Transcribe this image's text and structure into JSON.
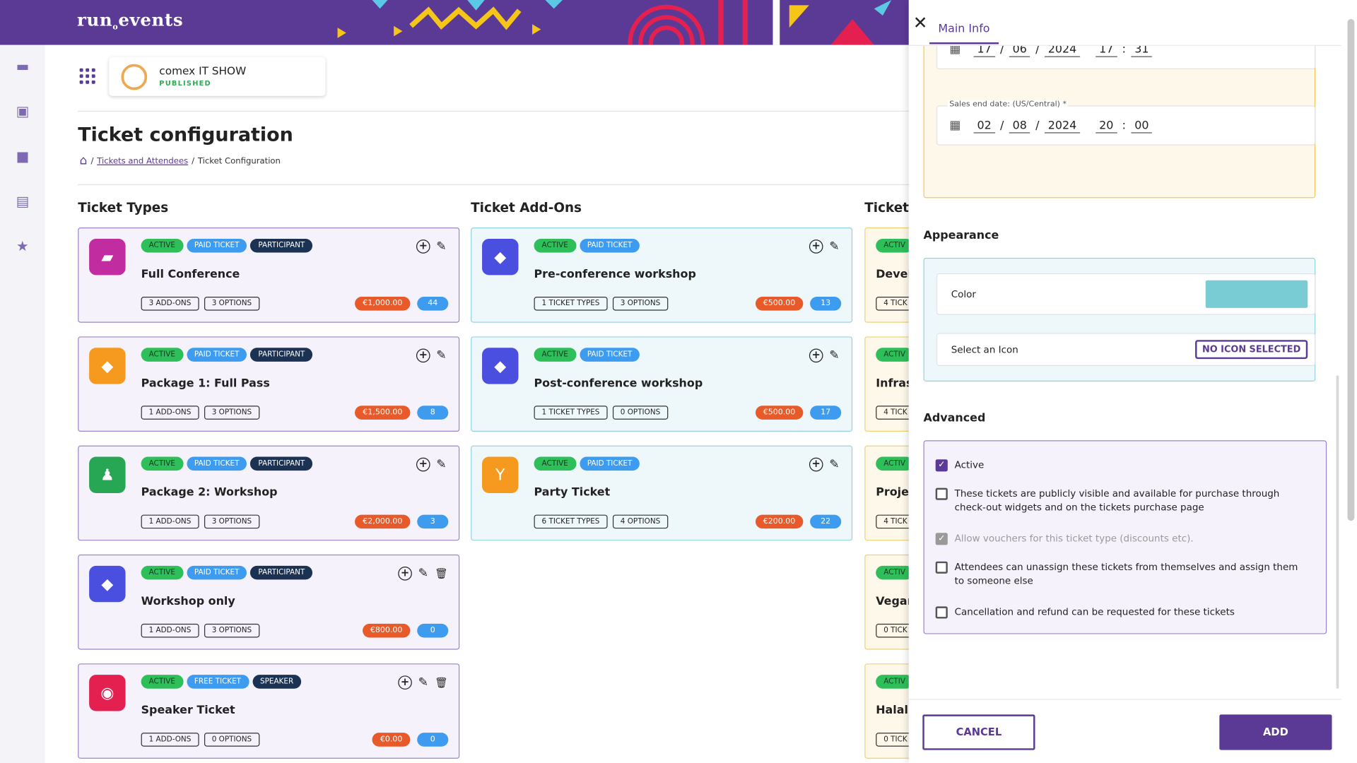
{
  "app": {
    "logo": "run events"
  },
  "event": {
    "name": "comex IT SHOW",
    "status": "PUBLISHED"
  },
  "page": {
    "title": "Ticket configuration",
    "breadcrumb": {
      "link": "Tickets and Attendees",
      "sep": "/",
      "current": "Ticket Configuration"
    }
  },
  "columns": {
    "types": "Ticket Types",
    "addons": "Ticket Add-Ons",
    "third": "Ticket"
  },
  "badges": {
    "active": "ACTIVE",
    "paid": "PAID TICKET",
    "free": "FREE TICKET",
    "participant": "PARTICIPANT",
    "speaker": "SPEAKER"
  },
  "ticket_types": [
    {
      "name": "Full Conference",
      "icon": "ticket-icon",
      "color": "#c12ca0",
      "badges": [
        "ACTIVE",
        "PAID TICKET",
        "PARTICIPANT"
      ],
      "pill1": "3 ADD-ONS",
      "pill2": "3 OPTIONS",
      "price": "€1,000.00",
      "count": "44",
      "delete": false
    },
    {
      "name": "Package 1: Full Pass",
      "icon": "graduation-cap-icon",
      "color": "#f59a1f",
      "badges": [
        "ACTIVE",
        "PAID TICKET",
        "PARTICIPANT"
      ],
      "pill1": "1 ADD-ONS",
      "pill2": "3 OPTIONS",
      "price": "€1,500.00",
      "count": "8",
      "delete": false
    },
    {
      "name": "Package 2: Workshop",
      "icon": "person-book-icon",
      "color": "#27a653",
      "badges": [
        "ACTIVE",
        "PAID TICKET",
        "PARTICIPANT"
      ],
      "pill1": "1 ADD-ONS",
      "pill2": "3 OPTIONS",
      "price": "€2,000.00",
      "count": "3",
      "delete": false
    },
    {
      "name": "Workshop only",
      "icon": "graduation-cap-icon",
      "color": "#4b4fe0",
      "badges": [
        "ACTIVE",
        "PAID TICKET",
        "PARTICIPANT"
      ],
      "pill1": "1 ADD-ONS",
      "pill2": "3 OPTIONS",
      "price": "€800.00",
      "count": "0",
      "delete": true
    },
    {
      "name": "Speaker Ticket",
      "icon": "speaker-icon",
      "color": "#e3204f",
      "badges": [
        "ACTIVE",
        "FREE TICKET",
        "SPEAKER"
      ],
      "pill1": "1 ADD-ONS",
      "pill2": "0 OPTIONS",
      "price": "€0.00",
      "count": "0",
      "delete": true
    }
  ],
  "ticket_addons": [
    {
      "name": "Pre-conference workshop",
      "icon": "graduation-cap-icon",
      "color": "#4b4fe0",
      "badges": [
        "ACTIVE",
        "PAID TICKET"
      ],
      "pill1": "1 TICKET TYPES",
      "pill2": "3 OPTIONS",
      "price": "€500.00",
      "count": "13"
    },
    {
      "name": "Post-conference workshop",
      "icon": "graduation-cap-icon",
      "color": "#4b4fe0",
      "badges": [
        "ACTIVE",
        "PAID TICKET"
      ],
      "pill1": "1 TICKET TYPES",
      "pill2": "0 OPTIONS",
      "price": "€500.00",
      "count": "17"
    },
    {
      "name": "Party Ticket",
      "icon": "cocktail-icon",
      "color": "#f59a1f",
      "badges": [
        "ACTIVE",
        "PAID TICKET"
      ],
      "pill1": "6 TICKET TYPES",
      "pill2": "4 OPTIONS",
      "price": "€200.00",
      "count": "22"
    }
  ],
  "third_col": [
    {
      "badge": "ACTIV",
      "name": "Devel",
      "pill": "4 TICK"
    },
    {
      "badge": "ACTIV",
      "name": "Infras",
      "pill": "4 TICK"
    },
    {
      "badge": "ACTIV",
      "name": "Projec",
      "pill": "4 TICK"
    },
    {
      "badge": "ACTIV",
      "name": "Vegan",
      "pill": "0 TICK"
    },
    {
      "badge": "ACTIV",
      "name": "Halal",
      "pill": "0 TICK"
    }
  ],
  "drawer": {
    "tab": "Main Info",
    "sales_start": {
      "day": "17",
      "month": "06",
      "year": "2024",
      "hour": "17",
      "minute": "31"
    },
    "sales_end": {
      "label": "Sales end date: (US/Central) *",
      "day": "02",
      "month": "08",
      "year": "2024",
      "hour": "20",
      "minute": "00"
    },
    "appearance": {
      "title": "Appearance",
      "color_label": "Color",
      "color_value": "#79ccd4",
      "icon_label": "Select an Icon",
      "icon_button": "NO ICON SELECTED"
    },
    "advanced": {
      "title": "Advanced",
      "options": [
        {
          "label": "Active",
          "state": "checked"
        },
        {
          "label": "These tickets are publicly visible and available for purchase through check-out widgets and on the tickets purchase page",
          "state": "unchecked"
        },
        {
          "label": "Allow vouchers for this ticket type (discounts etc).",
          "state": "disabled-checked"
        },
        {
          "label": "Attendees can unassign these tickets from themselves and assign them to someone else",
          "state": "unchecked"
        },
        {
          "label": "Cancellation and refund can be requested for these tickets",
          "state": "unchecked"
        }
      ]
    },
    "cancel": "CANCEL",
    "add": "ADD"
  },
  "colors": {
    "brand": "#5b3a96",
    "active": "#2fbf5a",
    "paid": "#3d9cf0",
    "participant": "#1c3253",
    "price": "#e85a2a"
  }
}
